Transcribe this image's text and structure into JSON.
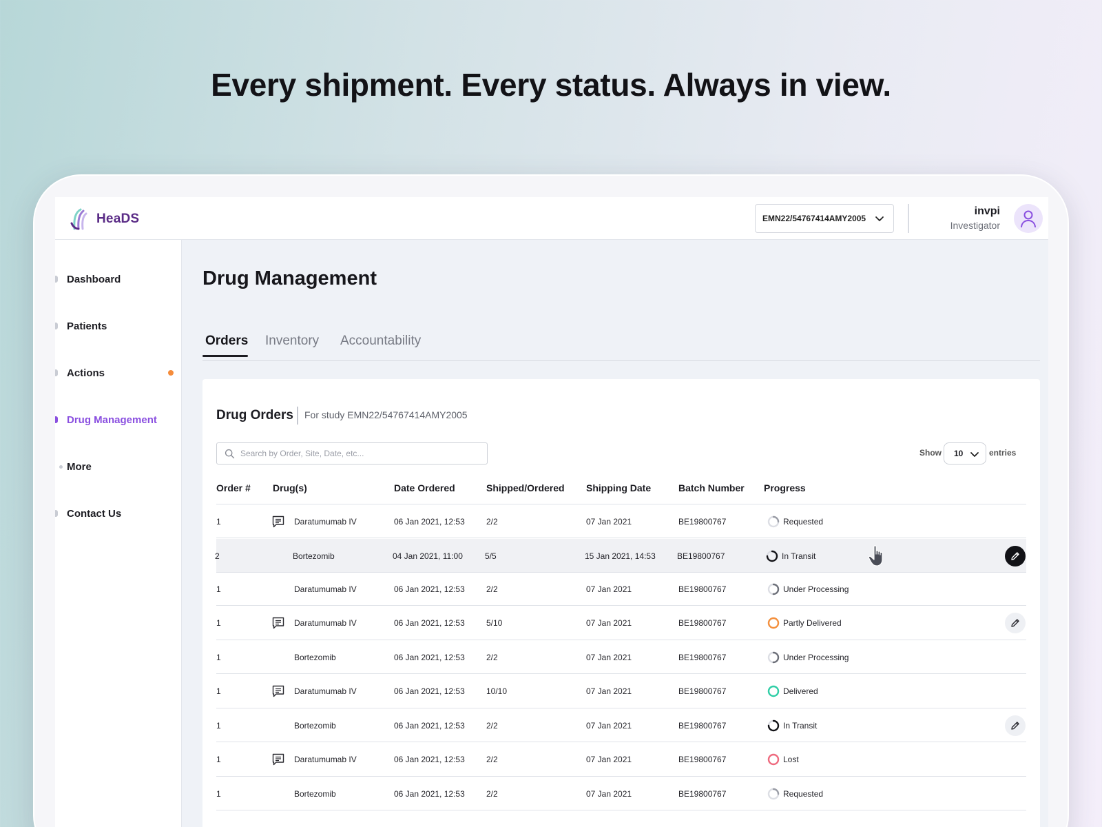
{
  "hero": {
    "title": "Every shipment. Every status. Always in view."
  },
  "app": {
    "logo_text": "HeaDS"
  },
  "topbar": {
    "study_id": "EMN22/54767414AMY2005",
    "user_name": "invpi",
    "user_role": "Investigator"
  },
  "sidebar": {
    "items": [
      {
        "label": "Dashboard",
        "active": false
      },
      {
        "label": "Patients",
        "active": false
      },
      {
        "label": "Actions",
        "active": false,
        "notification": true
      },
      {
        "label": "Drug Management",
        "active": true
      },
      {
        "label": "More",
        "active": false
      },
      {
        "label": "Contact Us",
        "active": false
      }
    ]
  },
  "main": {
    "page_title": "Drug Management",
    "tabs": [
      {
        "label": "Orders",
        "active": true
      },
      {
        "label": "Inventory",
        "active": false
      },
      {
        "label": "Accountability",
        "active": false
      }
    ],
    "card": {
      "title": "Drug Orders",
      "subtitle": "For study EMN22/54767414AMY2005",
      "search_placeholder": "Search by Order, Site, Date, etc...",
      "show_label": "Show",
      "show_value": "10",
      "entries_label": "entries"
    },
    "table": {
      "headers": [
        "Order #",
        "Drug(s)",
        "Date Ordered",
        "Shipped/Ordered",
        "Shipping Date",
        "Batch Number",
        "Progress"
      ],
      "rows": [
        {
          "order": "1",
          "drug": "Daratumumab IV",
          "comment": true,
          "date_ordered": "06 Jan 2021, 12:53",
          "shipped": "2/2",
          "shipping_date": "07 Jan 2021",
          "batch": "BE19800767",
          "progress": "Requested",
          "progress_color": "#9a9da6",
          "progress_fill": 0.25,
          "edit": "none"
        },
        {
          "order": "2",
          "drug": "Bortezomib",
          "comment": false,
          "date_ordered": "04 Jan 2021, 11:00",
          "shipped": "5/5",
          "shipping_date": "15 Jan 2021, 14:53",
          "batch": "BE19800767",
          "progress": "In Transit",
          "progress_color": "#121216",
          "progress_fill": 0.75,
          "edit": "dark",
          "hover": true
        },
        {
          "order": "1",
          "drug": "Daratumumab IV",
          "comment": false,
          "date_ordered": "06 Jan 2021, 12:53",
          "shipped": "2/2",
          "shipping_date": "07 Jan 2021",
          "batch": "BE19800767",
          "progress": "Under Processing",
          "progress_color": "#6d7079",
          "progress_fill": 0.5,
          "edit": "none"
        },
        {
          "order": "1",
          "drug": "Daratumumab IV",
          "comment": true,
          "date_ordered": "06 Jan 2021, 12:53",
          "shipped": "5/10",
          "shipping_date": "07 Jan 2021",
          "batch": "BE19800767",
          "progress": "Partly Delivered",
          "progress_color": "#f5903d",
          "progress_fill": 1,
          "edit": "light"
        },
        {
          "order": "1",
          "drug": "Bortezomib",
          "comment": false,
          "date_ordered": "06 Jan 2021, 12:53",
          "shipped": "2/2",
          "shipping_date": "07 Jan 2021",
          "batch": "BE19800767",
          "progress": "Under Processing",
          "progress_color": "#6d7079",
          "progress_fill": 0.5,
          "edit": "none"
        },
        {
          "order": "1",
          "drug": "Daratumumab IV",
          "comment": true,
          "date_ordered": "06 Jan 2021, 12:53",
          "shipped": "10/10",
          "shipping_date": "07 Jan 2021",
          "batch": "BE19800767",
          "progress": "Delivered",
          "progress_color": "#2ecfa6",
          "progress_fill": 1,
          "edit": "none"
        },
        {
          "order": "1",
          "drug": "Bortezomib",
          "comment": false,
          "date_ordered": "06 Jan 2021, 12:53",
          "shipped": "2/2",
          "shipping_date": "07 Jan 2021",
          "batch": "BE19800767",
          "progress": "In Transit",
          "progress_color": "#121216",
          "progress_fill": 0.75,
          "edit": "light"
        },
        {
          "order": "1",
          "drug": "Daratumumab IV",
          "comment": true,
          "date_ordered": "06 Jan 2021, 12:53",
          "shipped": "2/2",
          "shipping_date": "07 Jan 2021",
          "batch": "BE19800767",
          "progress": "Lost",
          "progress_color": "#f06a7e",
          "progress_fill": 1,
          "edit": "none"
        },
        {
          "order": "1",
          "drug": "Bortezomib",
          "comment": false,
          "date_ordered": "06 Jan 2021, 12:53",
          "shipped": "2/2",
          "shipping_date": "07 Jan 2021",
          "batch": "BE19800767",
          "progress": "Requested",
          "progress_color": "#9a9da6",
          "progress_fill": 0.25,
          "edit": "none"
        }
      ]
    }
  },
  "colors": {
    "accent": "#8a4fe0",
    "notification": "#f58c3b",
    "logo": "#5a2b86"
  }
}
